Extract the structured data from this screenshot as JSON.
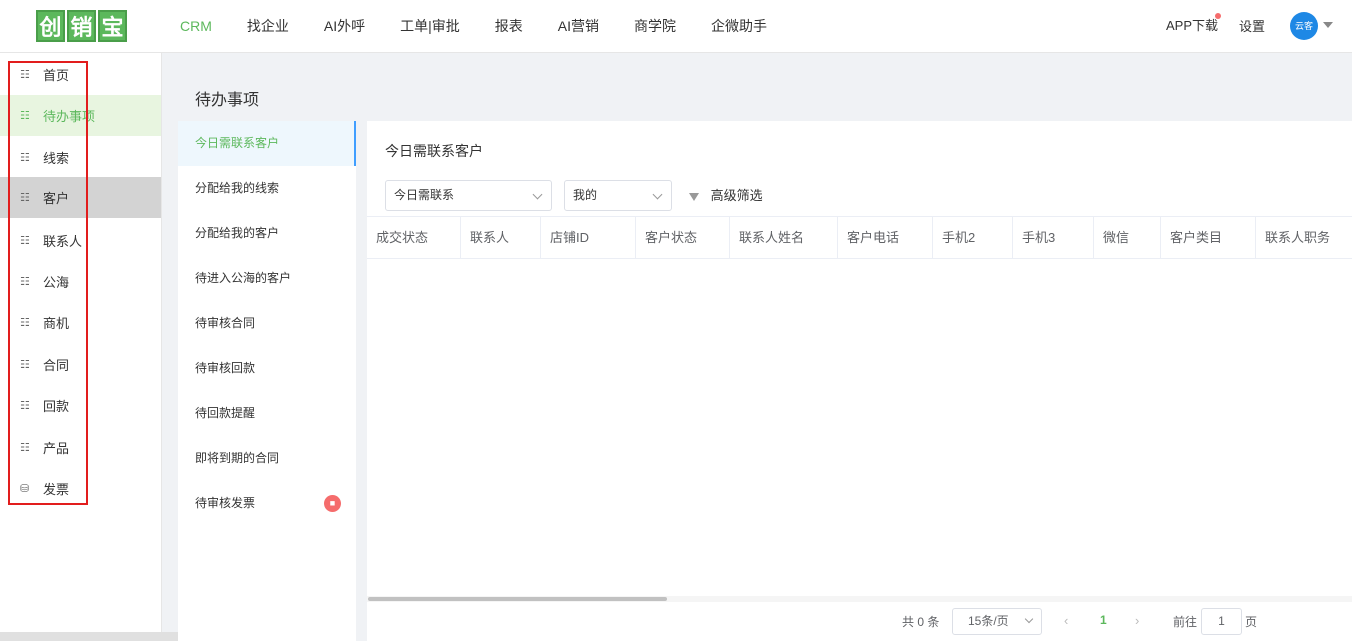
{
  "logo": {
    "chars": [
      "创",
      "销",
      "宝"
    ]
  },
  "nav": {
    "items": [
      "CRM",
      "找企业",
      "AI外呼",
      "工单|审批",
      "报表",
      "AI营销",
      "商学院",
      "企微助手"
    ],
    "active_index": 0
  },
  "header": {
    "app_download": "APP下载",
    "settings": "设置",
    "avatar_text": "云客"
  },
  "sidebar": {
    "items": [
      {
        "label": "首页",
        "icon": "org-tree-icon"
      },
      {
        "label": "待办事项",
        "icon": "org-tree-icon"
      },
      {
        "label": "线索",
        "icon": "org-tree-icon"
      },
      {
        "label": "客户",
        "icon": "org-tree-icon"
      },
      {
        "label": "联系人",
        "icon": "org-tree-icon"
      },
      {
        "label": "公海",
        "icon": "org-tree-icon"
      },
      {
        "label": "商机",
        "icon": "org-tree-icon"
      },
      {
        "label": "合同",
        "icon": "org-tree-icon"
      },
      {
        "label": "回款",
        "icon": "org-tree-icon"
      },
      {
        "label": "产品",
        "icon": "org-tree-icon"
      },
      {
        "label": "发票",
        "icon": "database-icon"
      }
    ]
  },
  "page": {
    "title": "待办事项"
  },
  "subnav": {
    "items": [
      "今日需联系客户",
      "分配给我的线索",
      "分配给我的客户",
      "待进入公海的客户",
      "待审核合同",
      "待审核回款",
      "待回款提醒",
      "即将到期的合同",
      "待审核发票"
    ]
  },
  "panel": {
    "title": "今日需联系客户",
    "filter_type": "今日需联系",
    "filter_scope": "我的",
    "advanced_filter": "高级筛选",
    "columns": [
      "成交状态",
      "联系人",
      "店铺ID",
      "客户状态",
      "联系人姓名",
      "客户电话",
      "手机2",
      "手机3",
      "微信",
      "客户类目",
      "联系人职务"
    ]
  },
  "pagination": {
    "total": "共 0 条",
    "page_size": "15条/页",
    "prev": "‹",
    "current": "1",
    "next": "›",
    "goto_label": "前往",
    "goto_value": "1",
    "page_unit": "页"
  },
  "colors": {
    "accent": "#5cb85c",
    "highlight_box": "#e21d1d"
  }
}
